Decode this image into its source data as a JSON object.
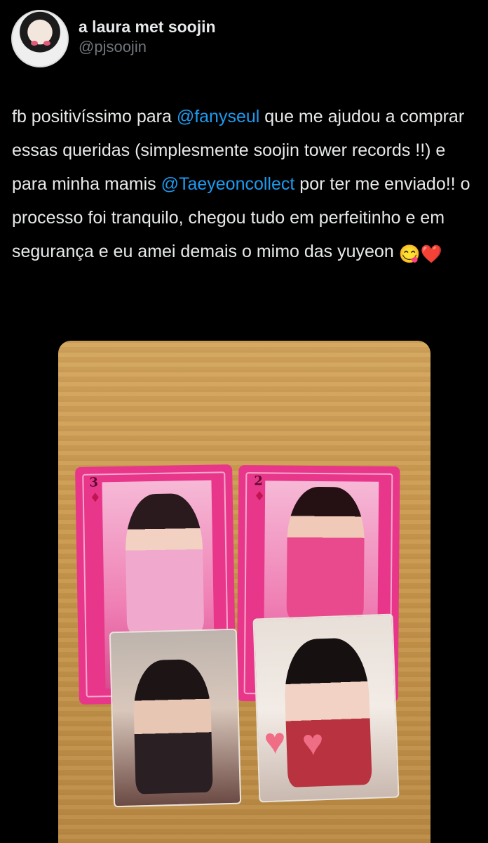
{
  "user": {
    "display_name": "a laura met soojin",
    "handle": "@pjsoojin"
  },
  "tweet": {
    "text_1": "fb positivíssimo para ",
    "mention_1": "@fanyseul",
    "text_2": " que me ajudou a comprar essas queridas (simplesmente soojin tower records !!) e para minha mamis ",
    "mention_2": "@Taeyeoncollect",
    "text_3": " por ter me enviado!! o processo foi tranquilo, chegou tudo em perfeitinho e em segurança e eu amei demais o mimo das yuyeon ",
    "emoji_1": "😋",
    "emoji_2": "❤️"
  },
  "photo": {
    "card_left_rank": "3",
    "card_left_suit": "♦",
    "card_right_rank": "2",
    "card_right_suit": "♦"
  },
  "colors": {
    "background": "#000000",
    "text": "#e7e9ea",
    "mention": "#1d9bf0",
    "handle": "#71767b"
  }
}
